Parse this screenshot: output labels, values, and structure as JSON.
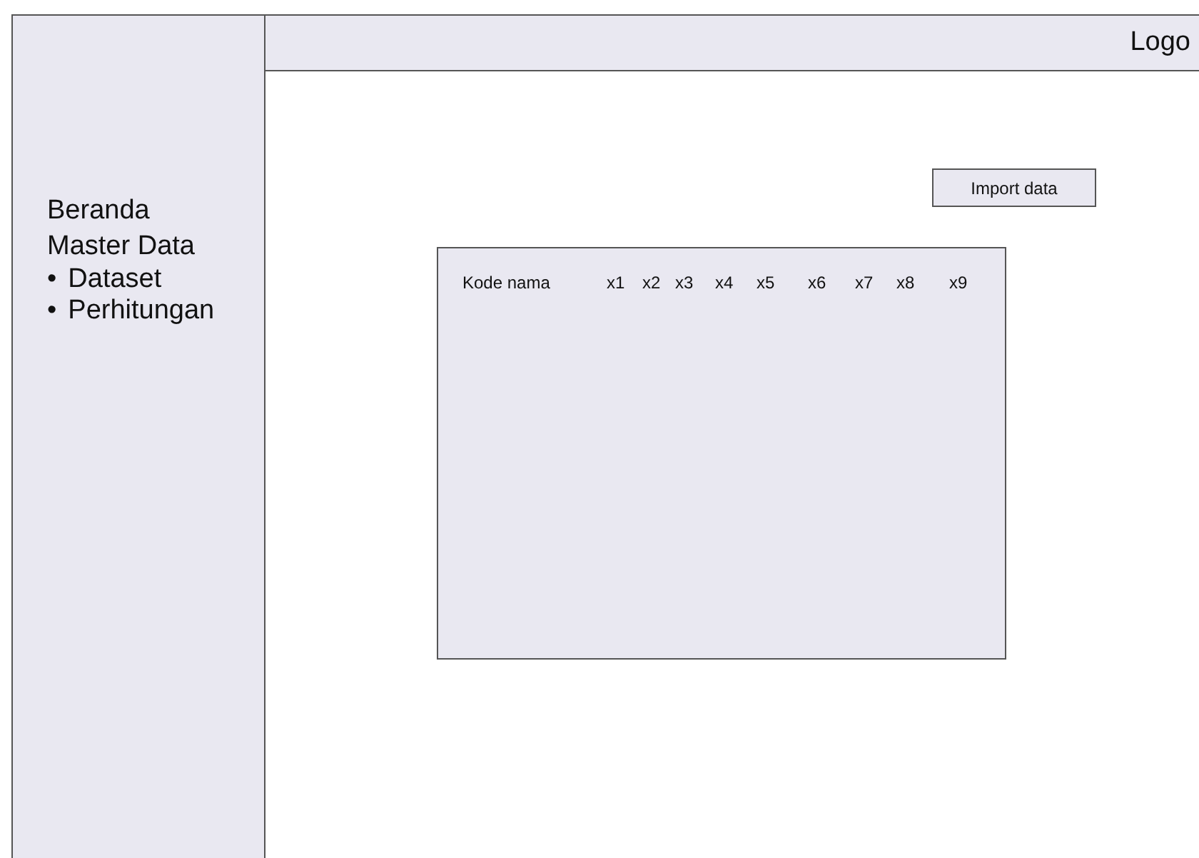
{
  "sidebar": {
    "items": [
      {
        "label": "Beranda"
      },
      {
        "label": "Master Data",
        "children": [
          {
            "bullet": "•",
            "label": "Dataset"
          },
          {
            "bullet": "•",
            "label": "Perhitungan"
          }
        ]
      }
    ]
  },
  "header": {
    "logo": "Logo"
  },
  "import_button": "Import data",
  "table": {
    "columns": [
      "Kode nama",
      "x1",
      "x2",
      "x3",
      "x4",
      "x5",
      "x6",
      "x7",
      "x8",
      "x9"
    ]
  }
}
